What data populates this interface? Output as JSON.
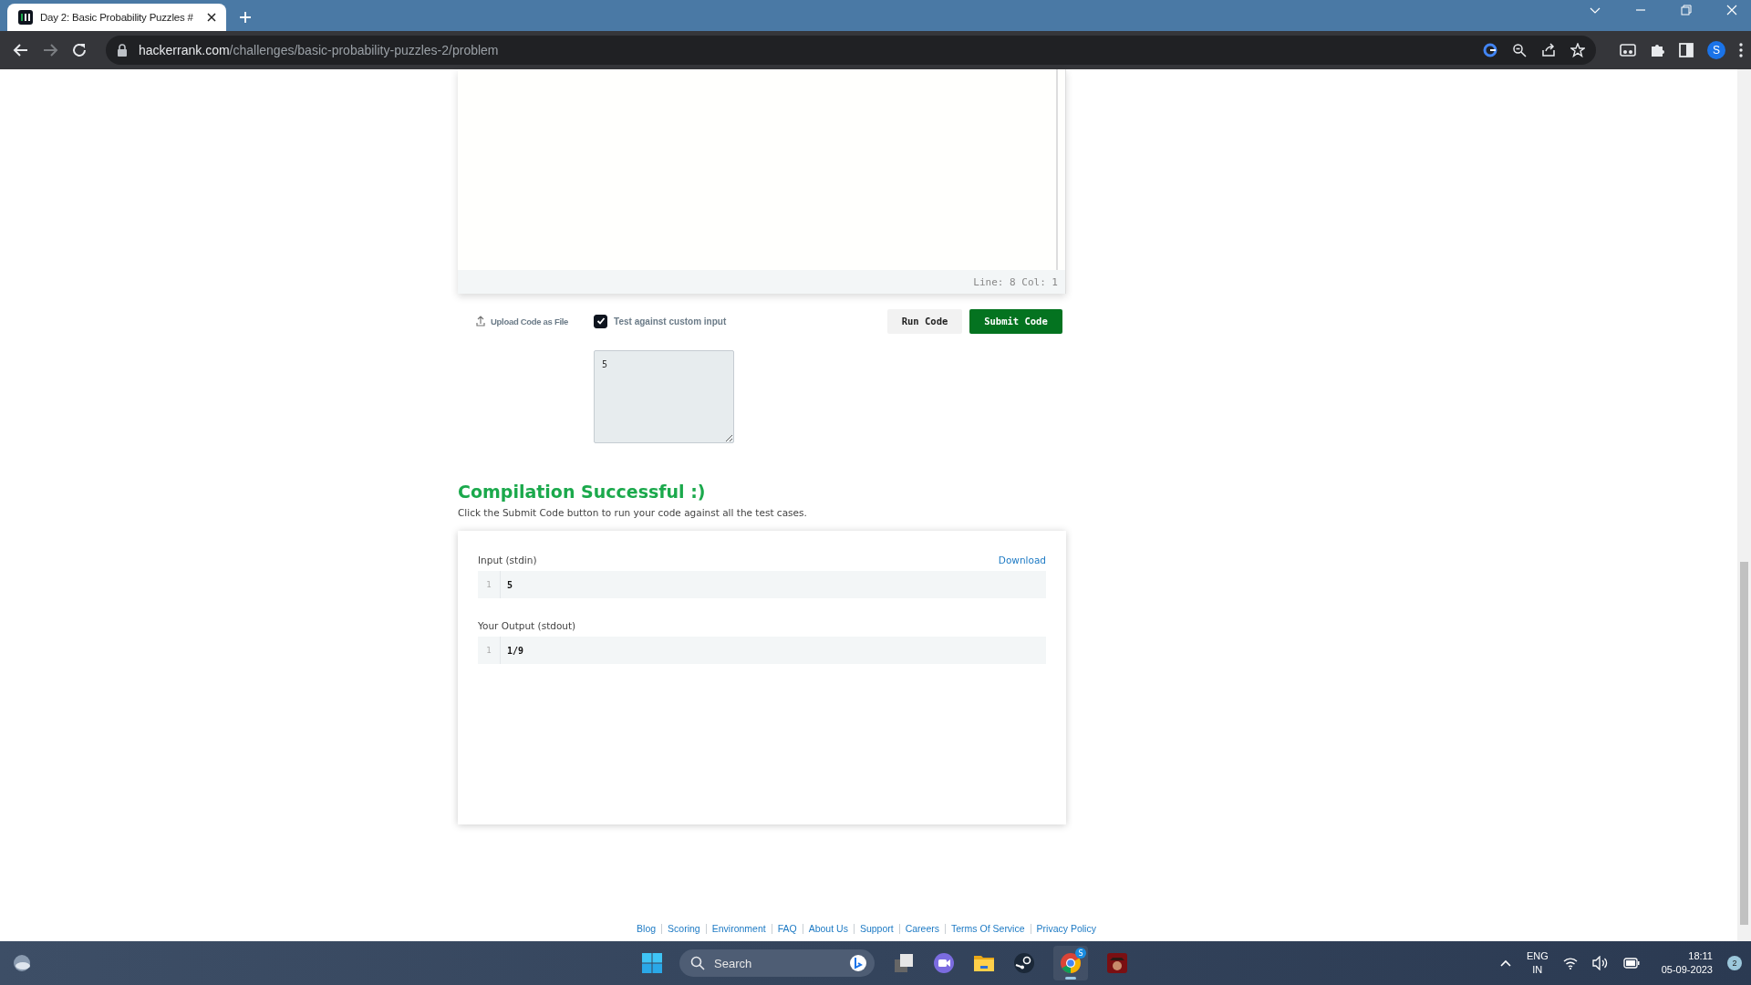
{
  "browser": {
    "tab": {
      "title": "Day 2: Basic Probability Puzzles #",
      "selected": true
    },
    "address": {
      "host": "hackerrank.com",
      "path": "/challenges/basic-probability-puzzles-2/problem"
    },
    "profile_initial": "S"
  },
  "editor": {
    "status": "Line: 8 Col: 1"
  },
  "actions": {
    "upload": "Upload Code as File",
    "custom_input": {
      "label": "Test against custom input",
      "checked": true
    },
    "run": "Run Code",
    "submit": "Submit Code"
  },
  "custom_input": {
    "value": "5"
  },
  "result": {
    "title": "Compilation Successful :)",
    "message": "Click the Submit Code button to run your code against all the test cases.",
    "sections": [
      {
        "label": "Input (stdin)",
        "action": "Download",
        "lines": [
          {
            "number": "1",
            "text": "5"
          }
        ]
      },
      {
        "label": "Your Output (stdout)",
        "lines": [
          {
            "number": "1",
            "text": "1/9"
          }
        ]
      }
    ]
  },
  "footer_links": [
    "Blog",
    "Scoring",
    "Environment",
    "FAQ",
    "About Us",
    "Support",
    "Careers",
    "Terms Of Service",
    "Privacy Policy"
  ],
  "taskbar": {
    "search": {
      "placeholder": "Search"
    },
    "chrome_badge": "S"
  },
  "tray": {
    "language": "ENG",
    "region": "IN",
    "time": "18:11",
    "date": "05-09-2023",
    "notifications": "2"
  }
}
